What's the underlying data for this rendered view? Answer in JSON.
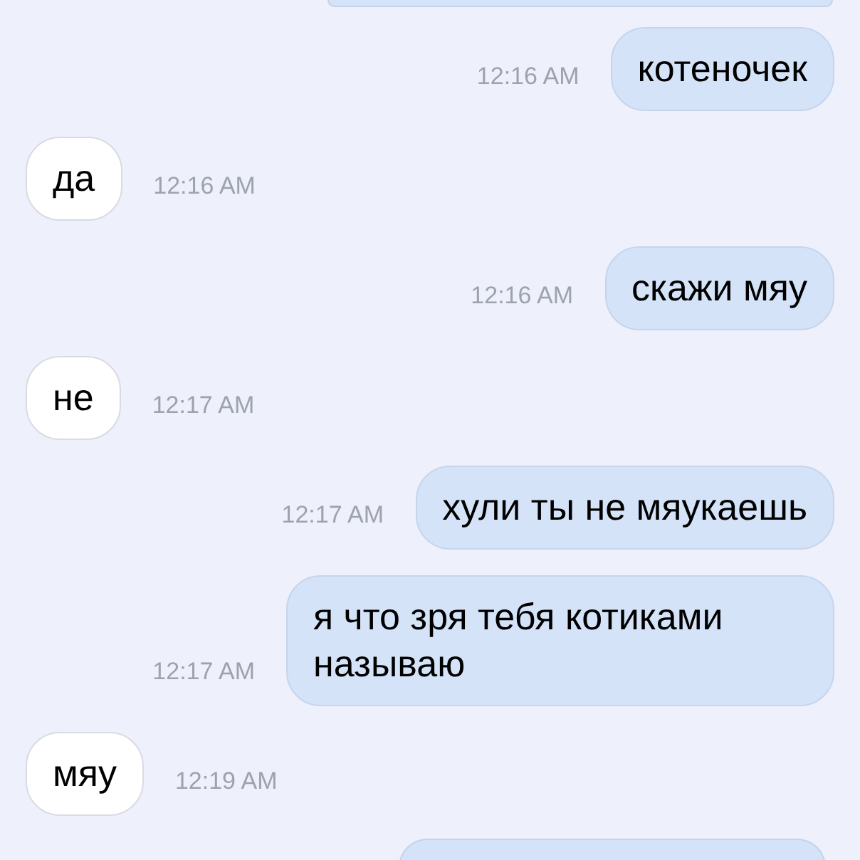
{
  "messages": [
    {
      "kind": "out",
      "text": "котеночек",
      "time": "12:16 AM"
    },
    {
      "kind": "in",
      "text": "да",
      "time": "12:16 AM"
    },
    {
      "kind": "out",
      "text": "скажи мяу",
      "time": "12:16 AM"
    },
    {
      "kind": "in",
      "text": "не",
      "time": "12:17 AM"
    },
    {
      "kind": "out",
      "text": "хули ты не мяукаешь",
      "time": "12:17 AM"
    },
    {
      "kind": "out",
      "text": "я что зря тебя котиками называю",
      "time": "12:17 AM"
    },
    {
      "kind": "in",
      "text": "мяу",
      "time": "12:19 AM"
    }
  ]
}
